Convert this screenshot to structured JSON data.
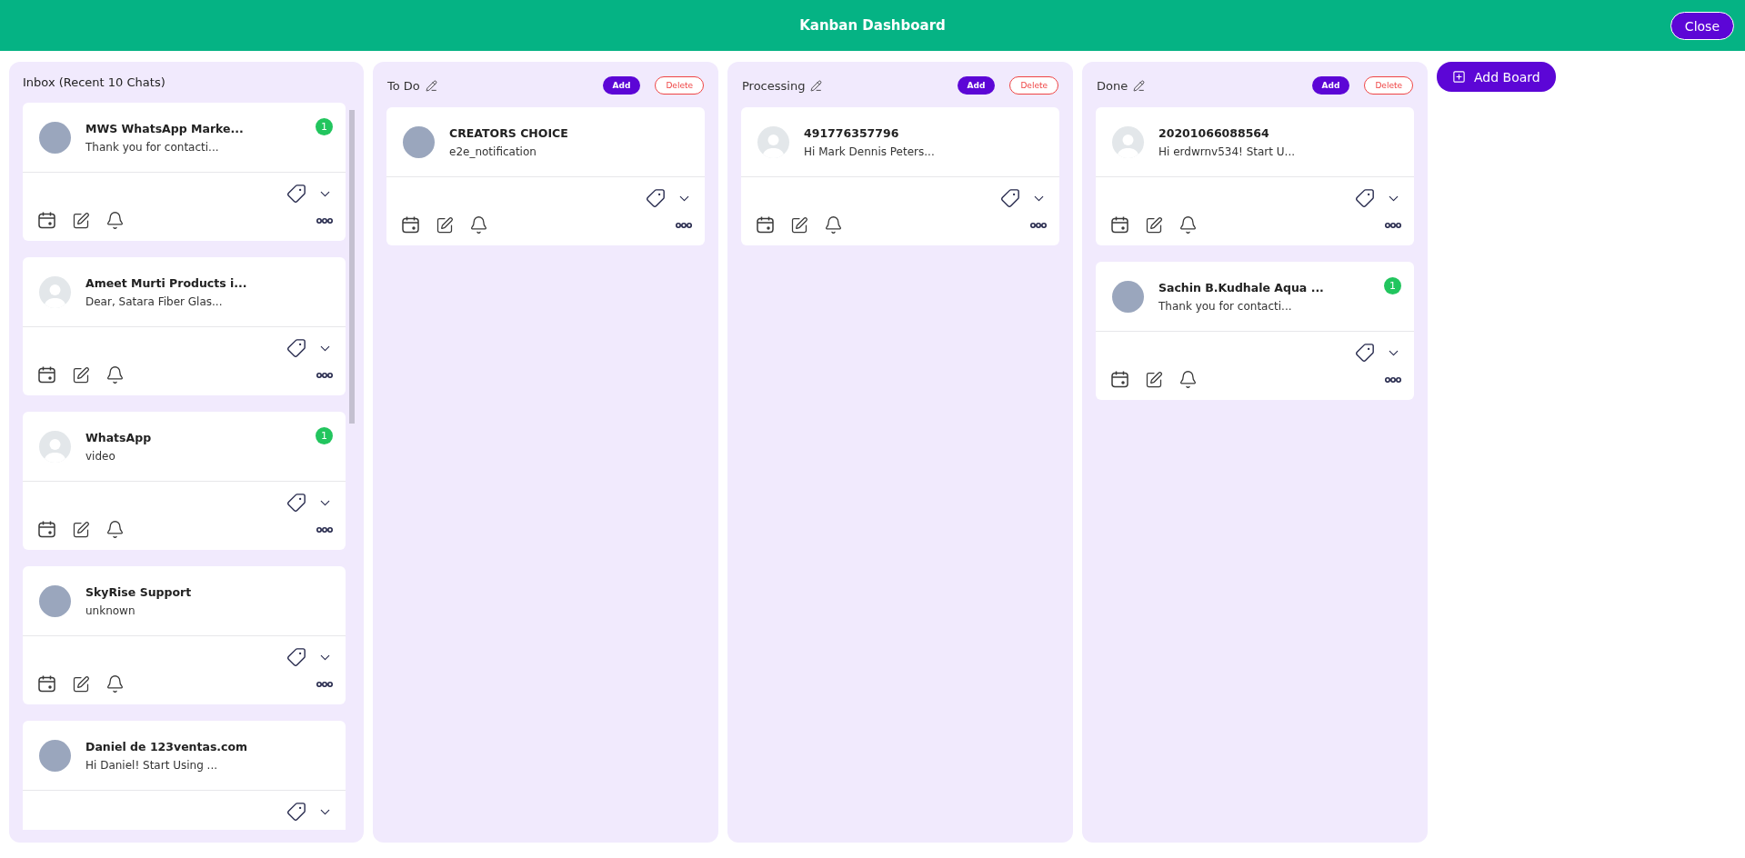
{
  "header": {
    "title": "Kanban Dashboard",
    "close_label": "Close"
  },
  "inbox": {
    "title": "Inbox (Recent 10 Chats)",
    "chats": [
      {
        "name": "MWS WhatsApp Marke...",
        "message": "Thank you for contacti...",
        "kind": "photo",
        "unread": "1"
      },
      {
        "name": "Ameet Murti Products i...",
        "message": "Dear, Satara Fiber Glas...",
        "kind": "default"
      },
      {
        "name": "WhatsApp",
        "message": "video",
        "kind": "default",
        "unread": "1"
      },
      {
        "name": "SkyRise Support",
        "message": "unknown",
        "kind": "photo"
      },
      {
        "name": "Daniel de 123ventas.com",
        "message": "Hi Daniel! Start Using ...",
        "kind": "photo"
      }
    ]
  },
  "boards": [
    {
      "title": "To Do",
      "add_label": "Add",
      "delete_label": "Delete",
      "chats": [
        {
          "name": "CREATORS CHOICE",
          "message": "e2e_notification",
          "kind": "photo"
        }
      ]
    },
    {
      "title": "Processing",
      "add_label": "Add",
      "delete_label": "Delete",
      "chats": [
        {
          "name": "491776357796",
          "message": "Hi Mark Dennis Peters...",
          "kind": "default"
        }
      ]
    },
    {
      "title": "Done",
      "add_label": "Add",
      "delete_label": "Delete",
      "chats": [
        {
          "name": "20201066088564",
          "message": "Hi erdwrnv534! Start U...",
          "kind": "default"
        },
        {
          "name": "Sachin B.Kudhale Aqua ...",
          "message": "Thank you for contacti...",
          "kind": "photo",
          "unread": "1"
        }
      ]
    }
  ],
  "add_board_label": "Add Board"
}
